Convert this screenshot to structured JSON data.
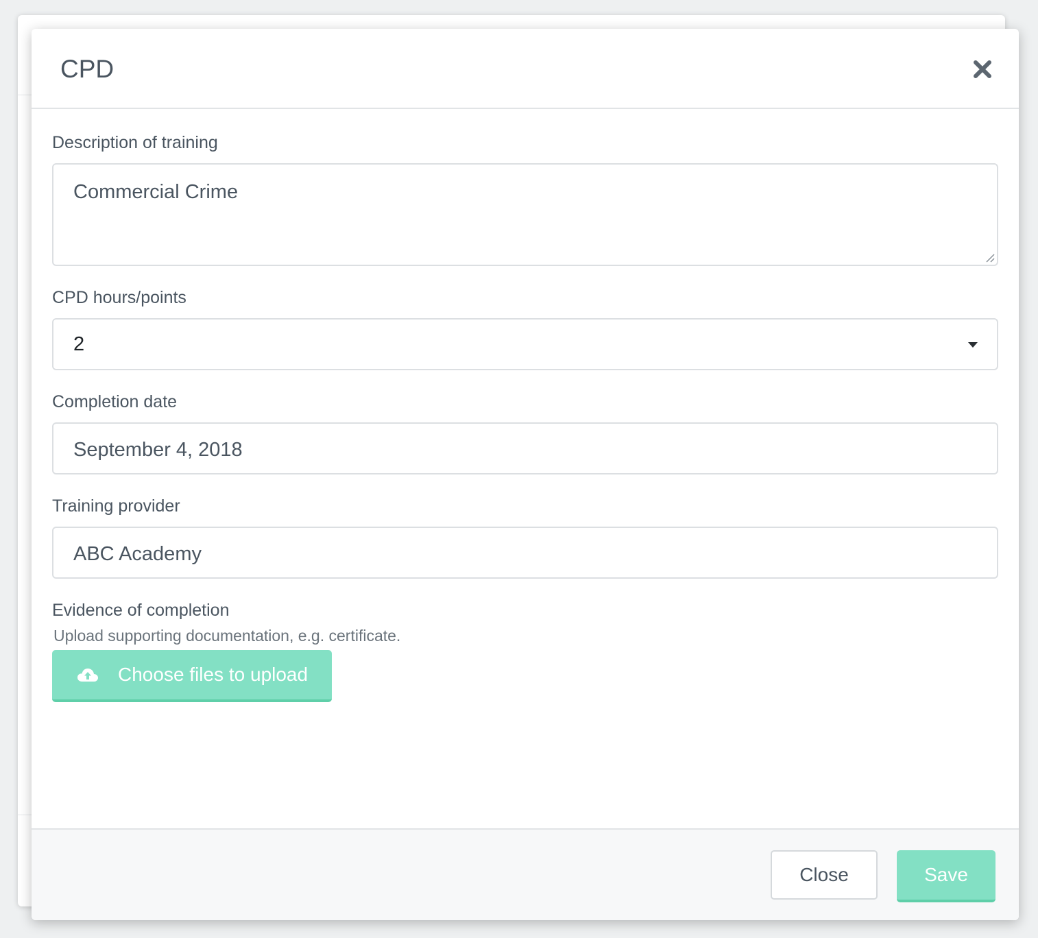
{
  "modal": {
    "title": "CPD",
    "close_icon": "close-icon"
  },
  "form": {
    "description": {
      "label": "Description of training",
      "value": "Commercial Crime"
    },
    "cpd_hours": {
      "label": "CPD hours/points",
      "selected": "2"
    },
    "completion_date": {
      "label": "Completion date",
      "value": "September 4, 2018"
    },
    "provider": {
      "label": "Training provider",
      "value": "ABC Academy"
    },
    "evidence": {
      "label": "Evidence of completion",
      "helper": "Upload supporting documentation, e.g. certificate.",
      "upload_label": "Choose files to upload",
      "upload_icon": "cloud-upload-icon"
    }
  },
  "footer": {
    "close_label": "Close",
    "save_label": "Save"
  },
  "colors": {
    "accent": "#83e0c4",
    "text": "#4a5560",
    "border": "#dcdfe2"
  }
}
